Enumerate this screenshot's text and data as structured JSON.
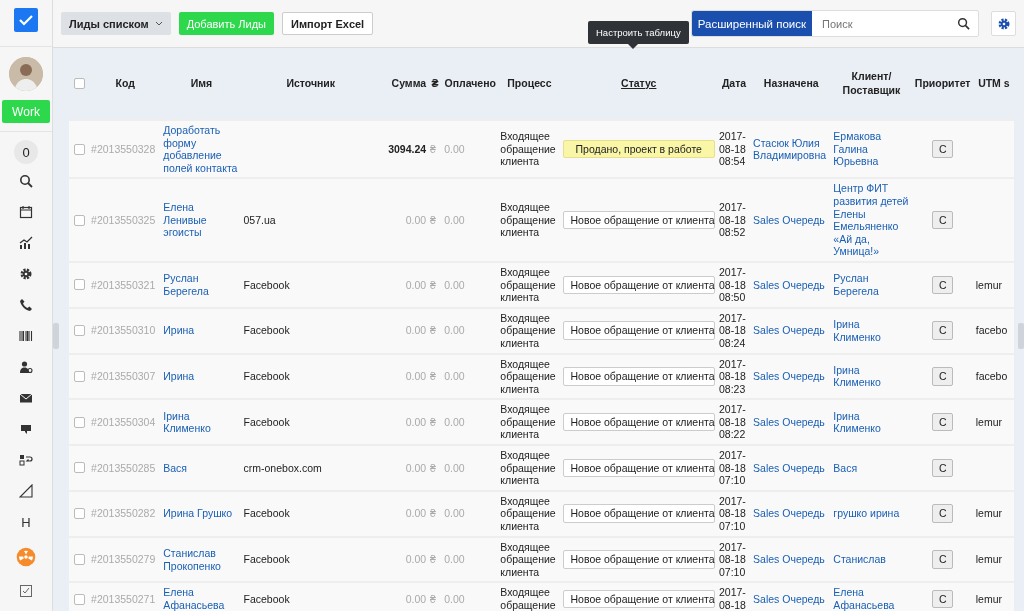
{
  "sidebar": {
    "work_button": "Work",
    "counter": "0",
    "letter_item": "H"
  },
  "toolbar": {
    "view_dropdown": "Лиды списком",
    "add_button": "Добавить Лиды",
    "import_button": "Импорт Excel",
    "advanced_search": "Расширенный поиск",
    "search": {
      "placeholder": "Поиск"
    },
    "tooltip": "Настроить таблицу"
  },
  "table": {
    "select_all_checked": false,
    "columns": [
      "Код",
      "Имя",
      "Источник",
      "Сумма",
      "₴",
      "Оплачено",
      "Процесс",
      "Статус",
      "Дата",
      "Назначена",
      "Клиент/ Поставщик",
      "Приоритет",
      "UTM s"
    ],
    "rows": [
      {
        "checked": false,
        "code": "#2013550328",
        "name": "Доработать форму добавление полей контакта",
        "source": "",
        "sum": "3094.24",
        "currency": "₴",
        "paid": "0.00",
        "process": "Входящее обращение клиента",
        "status": {
          "text": "Продано, проект в работе",
          "kind": "sold"
        },
        "date": "2017-08-18 08:54",
        "assigned": "Стасюк Юлия Владимировна",
        "client": "Ермакова Галина Юрьевна",
        "priority": "С",
        "utm": ""
      },
      {
        "checked": false,
        "code": "#2013550325",
        "name": "Елена Ленивые эгоисты",
        "source": "057.ua",
        "sum": "0.00",
        "currency": "₴",
        "paid": "0.00",
        "process": "Входящее обращение клиента",
        "status": {
          "text": "Новое обращение от клиента",
          "kind": "new"
        },
        "date": "2017-08-18 08:52",
        "assigned": "Sales Очередь",
        "client": "Центр ФИТ развития детей Елены Емельяненко «Ай да, Умница!»",
        "priority": "С",
        "utm": ""
      },
      {
        "checked": false,
        "code": "#2013550321",
        "name": "Руслан Берегела",
        "source": "Facebook",
        "sum": "0.00",
        "currency": "₴",
        "paid": "0.00",
        "process": "Входящее обращение клиента",
        "status": {
          "text": "Новое обращение от клиента",
          "kind": "new"
        },
        "date": "2017-08-18 08:50",
        "assigned": "Sales Очередь",
        "client": "Руслан Берегела",
        "priority": "С",
        "utm": "lemur"
      },
      {
        "checked": false,
        "code": "#2013550310",
        "name": "Ирина",
        "source": "Facebook",
        "sum": "0.00",
        "currency": "₴",
        "paid": "0.00",
        "process": "Входящее обращение клиента",
        "status": {
          "text": "Новое обращение от клиента",
          "kind": "new"
        },
        "date": "2017-08-18 08:24",
        "assigned": "Sales Очередь",
        "client": "Ірина Клименко",
        "priority": "С",
        "utm": "facebo"
      },
      {
        "checked": false,
        "code": "#2013550307",
        "name": "Ирина",
        "source": "Facebook",
        "sum": "0.00",
        "currency": "₴",
        "paid": "0.00",
        "process": "Входящее обращение клиента",
        "status": {
          "text": "Новое обращение от клиента",
          "kind": "new"
        },
        "date": "2017-08-18 08:23",
        "assigned": "Sales Очередь",
        "client": "Ірина Клименко",
        "priority": "С",
        "utm": "facebo"
      },
      {
        "checked": false,
        "code": "#2013550304",
        "name": "Ірина Клименко",
        "source": "Facebook",
        "sum": "0.00",
        "currency": "₴",
        "paid": "0.00",
        "process": "Входящее обращение клиента",
        "status": {
          "text": "Новое обращение от клиента",
          "kind": "new"
        },
        "date": "2017-08-18 08:22",
        "assigned": "Sales Очередь",
        "client": "Ірина Клименко",
        "priority": "С",
        "utm": "lemur"
      },
      {
        "checked": false,
        "code": "#2013550285",
        "name": "Вася",
        "source": "crm-onebox.com",
        "sum": "0.00",
        "currency": "₴",
        "paid": "0.00",
        "process": "Входящее обращение клиента",
        "status": {
          "text": "Новое обращение от клиента",
          "kind": "new"
        },
        "date": "2017-08-18 07:10",
        "assigned": "Sales Очередь",
        "client": "Вася",
        "priority": "С",
        "utm": ""
      },
      {
        "checked": false,
        "code": "#2013550282",
        "name": "Ирина Грушко",
        "source": "Facebook",
        "sum": "0.00",
        "currency": "₴",
        "paid": "0.00",
        "process": "Входящее обращение клиента",
        "status": {
          "text": "Новое обращение от клиента",
          "kind": "new"
        },
        "date": "2017-08-18 07:10",
        "assigned": "Sales Очередь",
        "client": "грушко ирина",
        "priority": "С",
        "utm": "lemur"
      },
      {
        "checked": false,
        "code": "#2013550279",
        "name": "Станислав Прокопенко",
        "source": "Facebook",
        "sum": "0.00",
        "currency": "₴",
        "paid": "0.00",
        "process": "Входящее обращение клиента",
        "status": {
          "text": "Новое обращение от клиента",
          "kind": "new"
        },
        "date": "2017-08-18 07:10",
        "assigned": "Sales Очередь",
        "client": "Станислав",
        "priority": "С",
        "utm": "lemur"
      },
      {
        "checked": false,
        "code": "#2013550271",
        "name": "Елена Афанасьева",
        "source": "Facebook",
        "sum": "0.00",
        "currency": "₴",
        "paid": "0.00",
        "process": "Входящее обращение",
        "status": {
          "text": "Новое обращение от клиента",
          "kind": "new"
        },
        "date": "2017-08-18",
        "assigned": "Sales Очередь",
        "client": "Елена Афанасьева",
        "priority": "С",
        "utm": "lemur"
      }
    ]
  }
}
